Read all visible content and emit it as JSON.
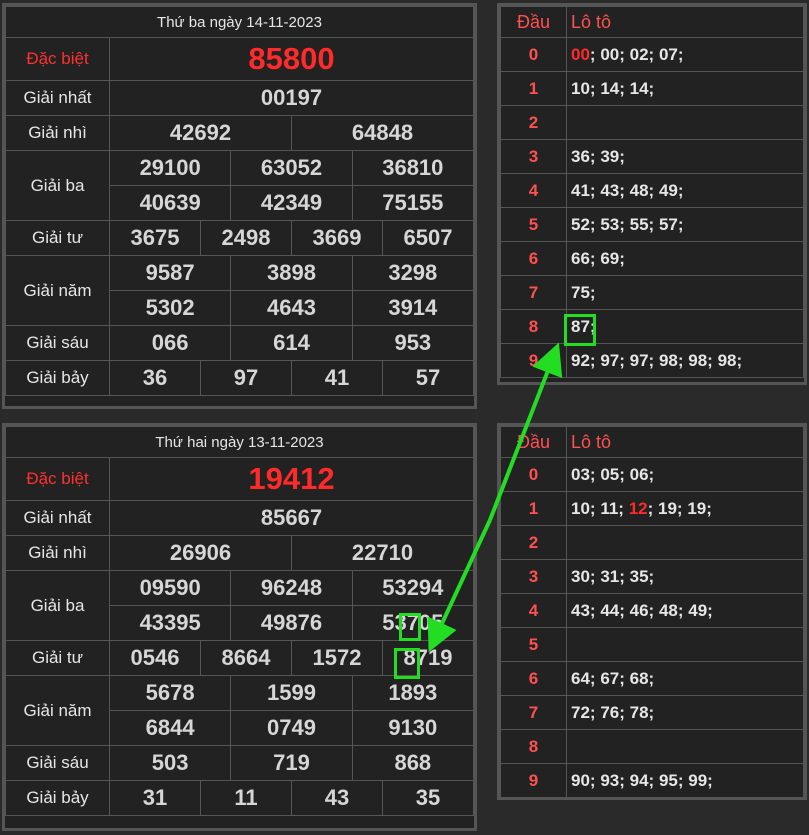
{
  "results": [
    {
      "date": "Thứ ba ngày 14-11-2023",
      "rows": [
        {
          "label": "Đặc biệt",
          "values": [
            "85800"
          ]
        },
        {
          "label": "Giải nhất",
          "values": [
            "00197"
          ]
        },
        {
          "label": "Giải nhì",
          "values": [
            "42692",
            "64848"
          ]
        },
        {
          "label": "Giải ba",
          "values": [
            "29100",
            "63052",
            "36810",
            "40639",
            "42349",
            "75155"
          ]
        },
        {
          "label": "Giải tư",
          "values": [
            "3675",
            "2498",
            "3669",
            "6507"
          ]
        },
        {
          "label": "Giải năm",
          "values": [
            "9587",
            "3898",
            "3298",
            "5302",
            "4643",
            "3914"
          ]
        },
        {
          "label": "Giải sáu",
          "values": [
            "066",
            "614",
            "953"
          ]
        },
        {
          "label": "Giải bảy",
          "values": [
            "36",
            "97",
            "41",
            "57"
          ]
        }
      ]
    },
    {
      "date": "Thứ hai ngày 13-11-2023",
      "rows": [
        {
          "label": "Đặc biệt",
          "values": [
            "19412"
          ]
        },
        {
          "label": "Giải nhất",
          "values": [
            "85667"
          ]
        },
        {
          "label": "Giải nhì",
          "values": [
            "26906",
            "22710"
          ]
        },
        {
          "label": "Giải ba",
          "values": [
            "09590",
            "96248",
            "53294",
            "43395",
            "49876",
            "53705"
          ]
        },
        {
          "label": "Giải tư",
          "values": [
            "0546",
            "8664",
            "1572",
            "8719"
          ]
        },
        {
          "label": "Giải năm",
          "values": [
            "5678",
            "1599",
            "1893",
            "6844",
            "0749",
            "9130"
          ]
        },
        {
          "label": "Giải sáu",
          "values": [
            "503",
            "719",
            "868"
          ]
        },
        {
          "label": "Giải bảy",
          "values": [
            "31",
            "11",
            "43",
            "35"
          ]
        }
      ]
    }
  ],
  "lotos": [
    {
      "header": {
        "dau": "Đầu",
        "loto": "Lô tô"
      },
      "rows": [
        {
          "dau": "0",
          "items": [
            {
              "v": "00",
              "hot": true
            },
            {
              "v": "00"
            },
            {
              "v": "02"
            },
            {
              "v": "07"
            }
          ]
        },
        {
          "dau": "1",
          "items": [
            {
              "v": "10"
            },
            {
              "v": "14"
            },
            {
              "v": "14"
            }
          ]
        },
        {
          "dau": "2",
          "items": []
        },
        {
          "dau": "3",
          "items": [
            {
              "v": "36"
            },
            {
              "v": "39"
            }
          ]
        },
        {
          "dau": "4",
          "items": [
            {
              "v": "41"
            },
            {
              "v": "43"
            },
            {
              "v": "48"
            },
            {
              "v": "49"
            }
          ]
        },
        {
          "dau": "5",
          "items": [
            {
              "v": "52"
            },
            {
              "v": "53"
            },
            {
              "v": "55"
            },
            {
              "v": "57"
            }
          ]
        },
        {
          "dau": "6",
          "items": [
            {
              "v": "66"
            },
            {
              "v": "69"
            }
          ]
        },
        {
          "dau": "7",
          "items": [
            {
              "v": "75"
            }
          ]
        },
        {
          "dau": "8",
          "items": [
            {
              "v": "87"
            }
          ]
        },
        {
          "dau": "9",
          "items": [
            {
              "v": "92"
            },
            {
              "v": "97"
            },
            {
              "v": "97"
            },
            {
              "v": "98"
            },
            {
              "v": "98"
            },
            {
              "v": "98"
            }
          ]
        }
      ]
    },
    {
      "header": {
        "dau": "Đầu",
        "loto": "Lô tô"
      },
      "rows": [
        {
          "dau": "0",
          "items": [
            {
              "v": "03"
            },
            {
              "v": "05"
            },
            {
              "v": "06"
            }
          ]
        },
        {
          "dau": "1",
          "items": [
            {
              "v": "10"
            },
            {
              "v": "11"
            },
            {
              "v": "12",
              "hot": true
            },
            {
              "v": "19"
            },
            {
              "v": "19"
            }
          ]
        },
        {
          "dau": "2",
          "items": []
        },
        {
          "dau": "3",
          "items": [
            {
              "v": "30"
            },
            {
              "v": "31"
            },
            {
              "v": "35"
            }
          ]
        },
        {
          "dau": "4",
          "items": [
            {
              "v": "43"
            },
            {
              "v": "44"
            },
            {
              "v": "46"
            },
            {
              "v": "48"
            },
            {
              "v": "49"
            }
          ]
        },
        {
          "dau": "5",
          "items": []
        },
        {
          "dau": "6",
          "items": [
            {
              "v": "64"
            },
            {
              "v": "67"
            },
            {
              "v": "68"
            }
          ]
        },
        {
          "dau": "7",
          "items": [
            {
              "v": "72"
            },
            {
              "v": "76"
            },
            {
              "v": "78"
            }
          ]
        },
        {
          "dau": "8",
          "items": []
        },
        {
          "dau": "9",
          "items": [
            {
              "v": "90"
            },
            {
              "v": "93"
            },
            {
              "v": "94"
            },
            {
              "v": "95"
            },
            {
              "v": "99"
            }
          ]
        }
      ]
    }
  ],
  "colors": {
    "jackpot": "#ff2a2a",
    "highlight": "#22dd22",
    "dau": "#ff5050"
  }
}
